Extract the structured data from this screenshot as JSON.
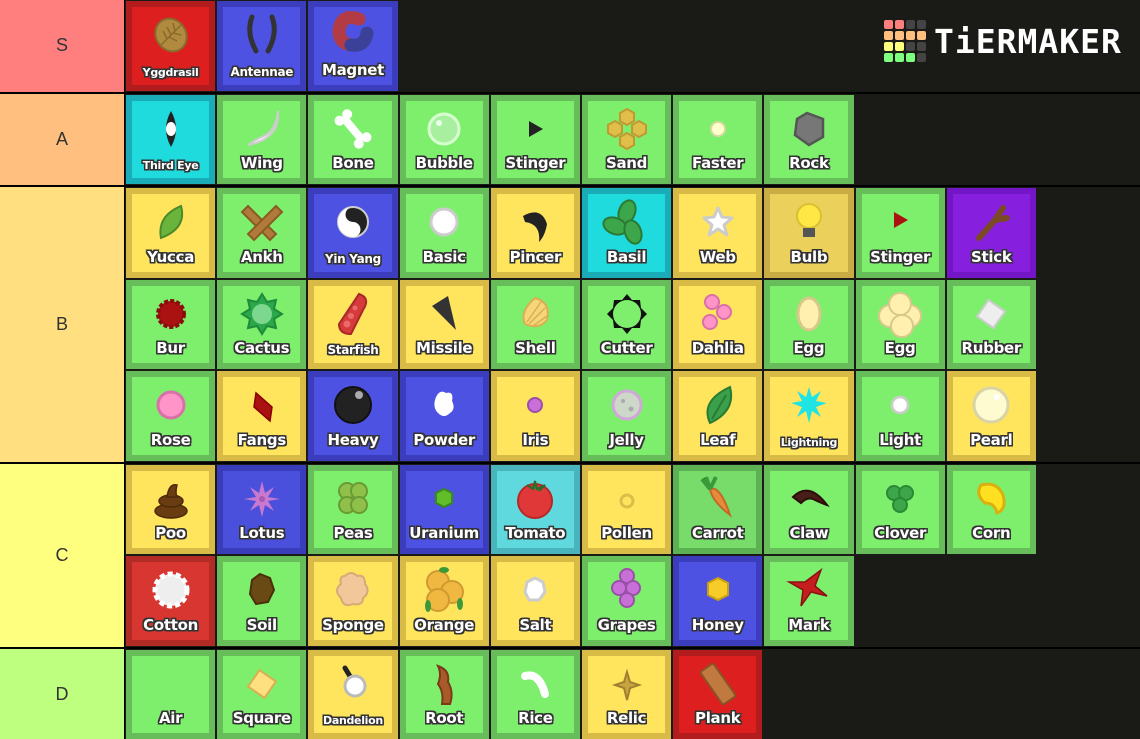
{
  "logo": {
    "text": "TiERMAKER",
    "grid_colors": [
      "#ff7f7f",
      "#ff7f7f",
      "#444444",
      "#444444",
      "#ffbf7f",
      "#ffbf7f",
      "#ffbf7f",
      "#ffbf7f",
      "#ffff7f",
      "#ffff7f",
      "#444444",
      "#444444",
      "#7fff7f",
      "#7fff7f",
      "#7fff7f",
      "#444444"
    ]
  },
  "tiers": [
    {
      "label": "S",
      "color": "#ff7f7f",
      "items": [
        {
          "name": "Yggdrasil",
          "rarity": "legend",
          "icon": "yggdrasil-leaf-icon"
        },
        {
          "name": "Antennae",
          "rarity": "rare",
          "icon": "antennae-icon"
        },
        {
          "name": "Magnet",
          "rarity": "rare",
          "icon": "magnet-icon"
        }
      ]
    },
    {
      "label": "A",
      "color": "#ffbf7f",
      "items": [
        {
          "name": "Third Eye",
          "rarity": "mythic",
          "icon": "third-eye-icon"
        },
        {
          "name": "Wing",
          "rarity": "common",
          "icon": "wing-icon"
        },
        {
          "name": "Bone",
          "rarity": "common",
          "icon": "bone-icon"
        },
        {
          "name": "Bubble",
          "rarity": "common",
          "icon": "bubble-icon"
        },
        {
          "name": "Stinger",
          "rarity": "common",
          "icon": "stinger-icon"
        },
        {
          "name": "Sand",
          "rarity": "common",
          "icon": "sand-icon"
        },
        {
          "name": "Faster",
          "rarity": "common",
          "icon": "faster-icon"
        },
        {
          "name": "Rock",
          "rarity": "common",
          "icon": "rock-icon"
        }
      ]
    },
    {
      "label": "B",
      "color": "#ffdf7f",
      "items": [
        {
          "name": "Yucca",
          "rarity": "unusual",
          "icon": "yucca-leaf-icon"
        },
        {
          "name": "Ankh",
          "rarity": "common",
          "icon": "ankh-icon"
        },
        {
          "name": "Yin Yang",
          "rarity": "rare",
          "icon": "yin-yang-icon"
        },
        {
          "name": "Basic",
          "rarity": "common",
          "icon": "basic-petal-icon"
        },
        {
          "name": "Pincer",
          "rarity": "unusual",
          "icon": "pincer-icon"
        },
        {
          "name": "Basil",
          "rarity": "mythic",
          "icon": "basil-icon"
        },
        {
          "name": "Web",
          "rarity": "unusual",
          "icon": "web-icon"
        },
        {
          "name": "Bulb",
          "rarity": "soft-unusual",
          "icon": "bulb-icon"
        },
        {
          "name": "Stinger",
          "rarity": "common",
          "icon": "red-stinger-icon"
        },
        {
          "name": "Stick",
          "rarity": "epic",
          "icon": "stick-icon"
        },
        {
          "name": "Bur",
          "rarity": "common",
          "icon": "bur-icon"
        },
        {
          "name": "Cactus",
          "rarity": "common",
          "icon": "cactus-icon"
        },
        {
          "name": "Starfish",
          "rarity": "unusual",
          "icon": "starfish-icon"
        },
        {
          "name": "Missile",
          "rarity": "unusual",
          "icon": "missile-icon"
        },
        {
          "name": "Shell",
          "rarity": "common",
          "icon": "shell-icon"
        },
        {
          "name": "Cutter",
          "rarity": "common",
          "icon": "cutter-icon"
        },
        {
          "name": "Dahlia",
          "rarity": "unusual",
          "icon": "dahlia-icon"
        },
        {
          "name": "Egg",
          "rarity": "common",
          "icon": "egg-icon"
        },
        {
          "name": "Egg",
          "rarity": "common",
          "icon": "egg-cluster-icon"
        },
        {
          "name": "Rubber",
          "rarity": "common",
          "icon": "rubber-icon"
        },
        {
          "name": "Rose",
          "rarity": "common",
          "icon": "rose-icon"
        },
        {
          "name": "Fangs",
          "rarity": "unusual",
          "icon": "fangs-icon"
        },
        {
          "name": "Heavy",
          "rarity": "rare",
          "icon": "heavy-ball-icon"
        },
        {
          "name": "Powder",
          "rarity": "rare",
          "icon": "powder-icon"
        },
        {
          "name": "Iris",
          "rarity": "unusual",
          "icon": "iris-icon"
        },
        {
          "name": "Jelly",
          "rarity": "common",
          "icon": "jelly-icon"
        },
        {
          "name": "Leaf",
          "rarity": "unusual",
          "icon": "leaf-icon"
        },
        {
          "name": "Lightning",
          "rarity": "unusual",
          "icon": "lightning-icon"
        },
        {
          "name": "Light",
          "rarity": "common",
          "icon": "light-icon"
        },
        {
          "name": "Pearl",
          "rarity": "unusual",
          "icon": "pearl-icon"
        }
      ]
    },
    {
      "label": "C",
      "color": "#ffff7f",
      "items": [
        {
          "name": "Poo",
          "rarity": "unusual",
          "icon": "poo-icon"
        },
        {
          "name": "Lotus",
          "rarity": "soft-rare",
          "icon": "lotus-icon"
        },
        {
          "name": "Peas",
          "rarity": "common",
          "icon": "peas-icon"
        },
        {
          "name": "Uranium",
          "rarity": "rare",
          "icon": "uranium-icon"
        },
        {
          "name": "Tomato",
          "rarity": "soft-mythic",
          "icon": "tomato-icon"
        },
        {
          "name": "Pollen",
          "rarity": "unusual",
          "icon": "pollen-icon"
        },
        {
          "name": "Carrot",
          "rarity": "soft-common",
          "icon": "carrot-icon"
        },
        {
          "name": "Claw",
          "rarity": "common",
          "icon": "claw-icon"
        },
        {
          "name": "Clover",
          "rarity": "common",
          "icon": "clover-icon"
        },
        {
          "name": "Corn",
          "rarity": "common",
          "icon": "corn-icon"
        },
        {
          "name": "Cotton",
          "rarity": "soft-legend",
          "icon": "cotton-icon"
        },
        {
          "name": "Soil",
          "rarity": "common",
          "icon": "soil-icon"
        },
        {
          "name": "Sponge",
          "rarity": "unusual",
          "icon": "sponge-icon"
        },
        {
          "name": "Orange",
          "rarity": "unusual",
          "icon": "orange-icon"
        },
        {
          "name": "Salt",
          "rarity": "unusual",
          "icon": "salt-icon"
        },
        {
          "name": "Grapes",
          "rarity": "common",
          "icon": "grapes-icon"
        },
        {
          "name": "Honey",
          "rarity": "rare",
          "icon": "honey-icon"
        },
        {
          "name": "Mark",
          "rarity": "common",
          "icon": "mark-star-icon"
        }
      ]
    },
    {
      "label": "D",
      "color": "#bfff7f",
      "items": [
        {
          "name": "Air",
          "rarity": "common",
          "icon": "air-icon"
        },
        {
          "name": "Square",
          "rarity": "common",
          "icon": "square-icon"
        },
        {
          "name": "Dandelion",
          "rarity": "unusual",
          "icon": "dandelion-icon"
        },
        {
          "name": "Root",
          "rarity": "common",
          "icon": "root-icon"
        },
        {
          "name": "Rice",
          "rarity": "common",
          "icon": "rice-icon"
        },
        {
          "name": "Relic",
          "rarity": "unusual",
          "icon": "relic-icon"
        },
        {
          "name": "Plank",
          "rarity": "legend",
          "icon": "plank-icon"
        }
      ]
    }
  ]
}
